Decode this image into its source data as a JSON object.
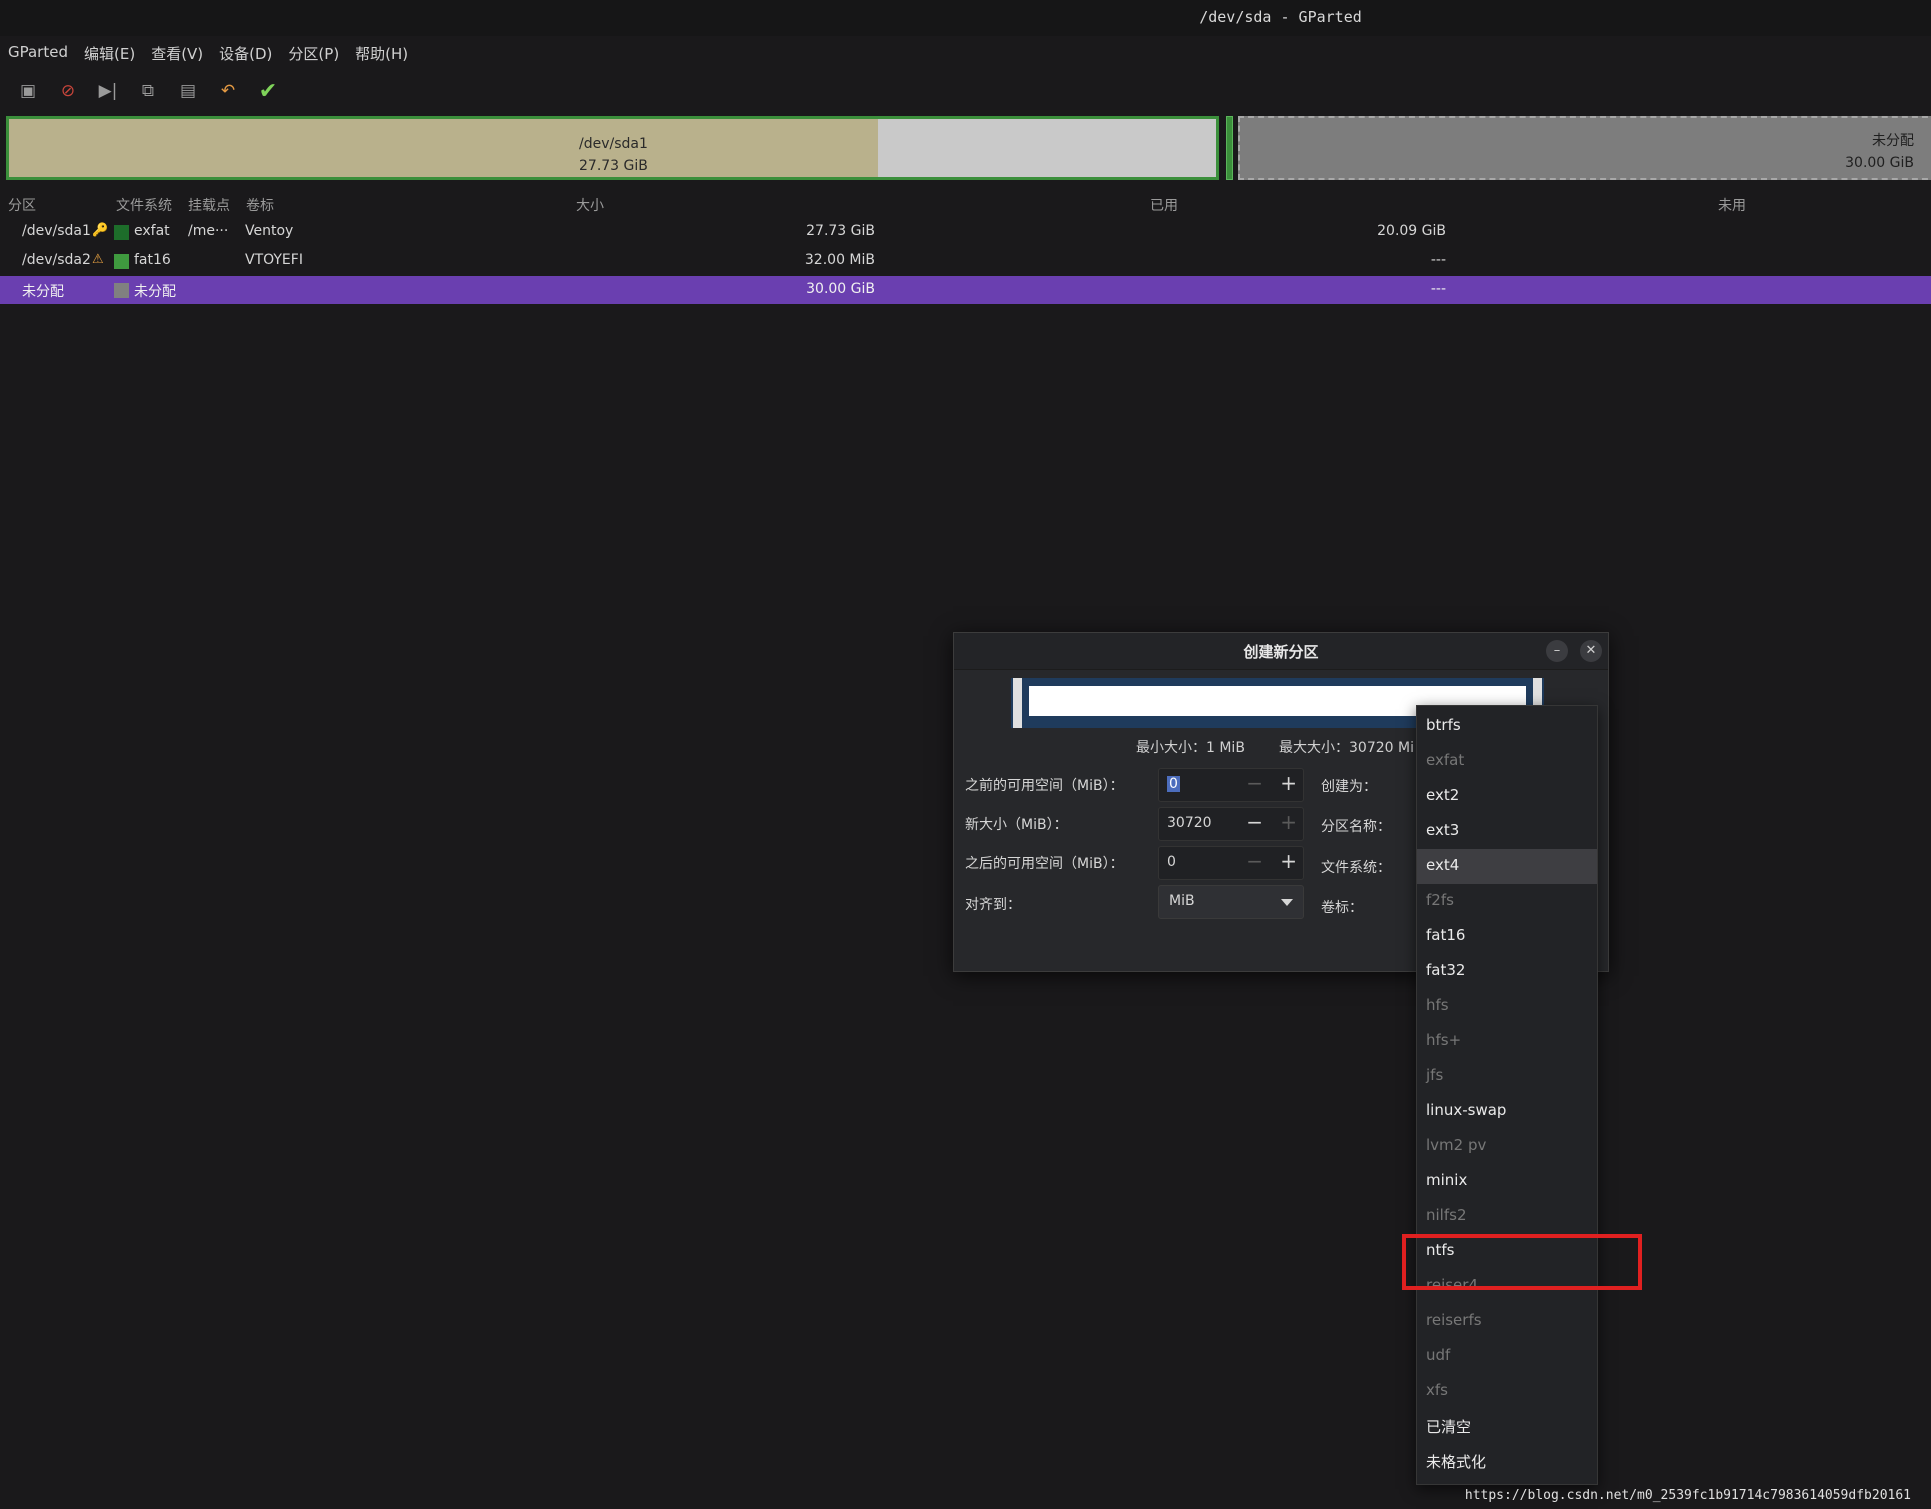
{
  "window": {
    "title": "/dev/sda - GParted"
  },
  "menu": [
    "GParted",
    "编辑(E)",
    "查看(V)",
    "设备(D)",
    "分区(P)",
    "帮助(H)"
  ],
  "toolbar": [
    {
      "name": "new-icon",
      "glyph": "▣"
    },
    {
      "name": "delete-icon",
      "glyph": "⊘"
    },
    {
      "name": "resize-move-icon",
      "glyph": "▶|"
    },
    {
      "name": "copy-icon",
      "glyph": "⧉"
    },
    {
      "name": "paste-icon",
      "glyph": "▤"
    },
    {
      "name": "undo-icon",
      "glyph": "↶"
    },
    {
      "name": "apply-icon",
      "glyph": "✔"
    }
  ],
  "diskmap": {
    "sda1": {
      "name": "/dev/sda1",
      "size": "27.73 GiB",
      "used_fraction": 0.72
    },
    "unalloc": {
      "name": "未分配",
      "size": "30.00 GiB"
    }
  },
  "table": {
    "headers": [
      "分区",
      "文件系统",
      "挂载点",
      "卷标",
      "大小",
      "已用",
      "未用"
    ],
    "rows": [
      {
        "partition": "/dev/sda1",
        "badge": "🔑",
        "fs_color": "#1d6d2a",
        "fs": "exfat",
        "mount": "/me···",
        "label": "Ventoy",
        "size": "27.73 GiB",
        "used": "20.09 GiB",
        "unused": ""
      },
      {
        "partition": "/dev/sda2",
        "badge": "⚠",
        "fs_color": "#3f9a3f",
        "fs": "fat16",
        "mount": "",
        "label": "VTOYEFI",
        "size": "32.00 MiB",
        "used": "---",
        "unused": ""
      },
      {
        "partition": "未分配",
        "badge": "",
        "fs_color": "#808080",
        "fs": "未分配",
        "mount": "",
        "label": "",
        "size": "30.00 GiB",
        "used": "---",
        "unused": "",
        "selected": true
      }
    ]
  },
  "dialog": {
    "title": "创建新分区",
    "min_size": "最小大小：1 MiB",
    "max_size": "最大大小：30720 Mi",
    "before_label": "之前的可用空间（MiB）：",
    "before_value": "0",
    "new_size_label": "新大小（MiB）：",
    "new_size_value": "30720",
    "after_label": "之后的可用空间（MiB）：",
    "after_value": "0",
    "align_label": "对齐到：",
    "align_value": "MiB",
    "create_as_label": "创建为：",
    "partition_name_label": "分区名称：",
    "filesystem_label": "文件系统：",
    "volume_label_label": "卷标："
  },
  "filesystems": [
    {
      "name": "btrfs",
      "enabled": true
    },
    {
      "name": "exfat",
      "enabled": false
    },
    {
      "name": "ext2",
      "enabled": true
    },
    {
      "name": "ext3",
      "enabled": true
    },
    {
      "name": "ext4",
      "enabled": true,
      "hover": true
    },
    {
      "name": "f2fs",
      "enabled": false
    },
    {
      "name": "fat16",
      "enabled": true
    },
    {
      "name": "fat32",
      "enabled": true
    },
    {
      "name": "hfs",
      "enabled": false
    },
    {
      "name": "hfs+",
      "enabled": false
    },
    {
      "name": "jfs",
      "enabled": false
    },
    {
      "name": "linux-swap",
      "enabled": true
    },
    {
      "name": "lvm2 pv",
      "enabled": false
    },
    {
      "name": "minix",
      "enabled": true
    },
    {
      "name": "nilfs2",
      "enabled": false
    },
    {
      "name": "ntfs",
      "enabled": true
    },
    {
      "name": "reiser4",
      "enabled": false
    },
    {
      "name": "reiserfs",
      "enabled": false
    },
    {
      "name": "udf",
      "enabled": false
    },
    {
      "name": "xfs",
      "enabled": false
    },
    {
      "name": "已清空",
      "enabled": true
    },
    {
      "name": "未格式化",
      "enabled": true
    }
  ],
  "watermark": "https://blog.csdn.net/m0_2539fc1b91714c7983614059dfb20161"
}
